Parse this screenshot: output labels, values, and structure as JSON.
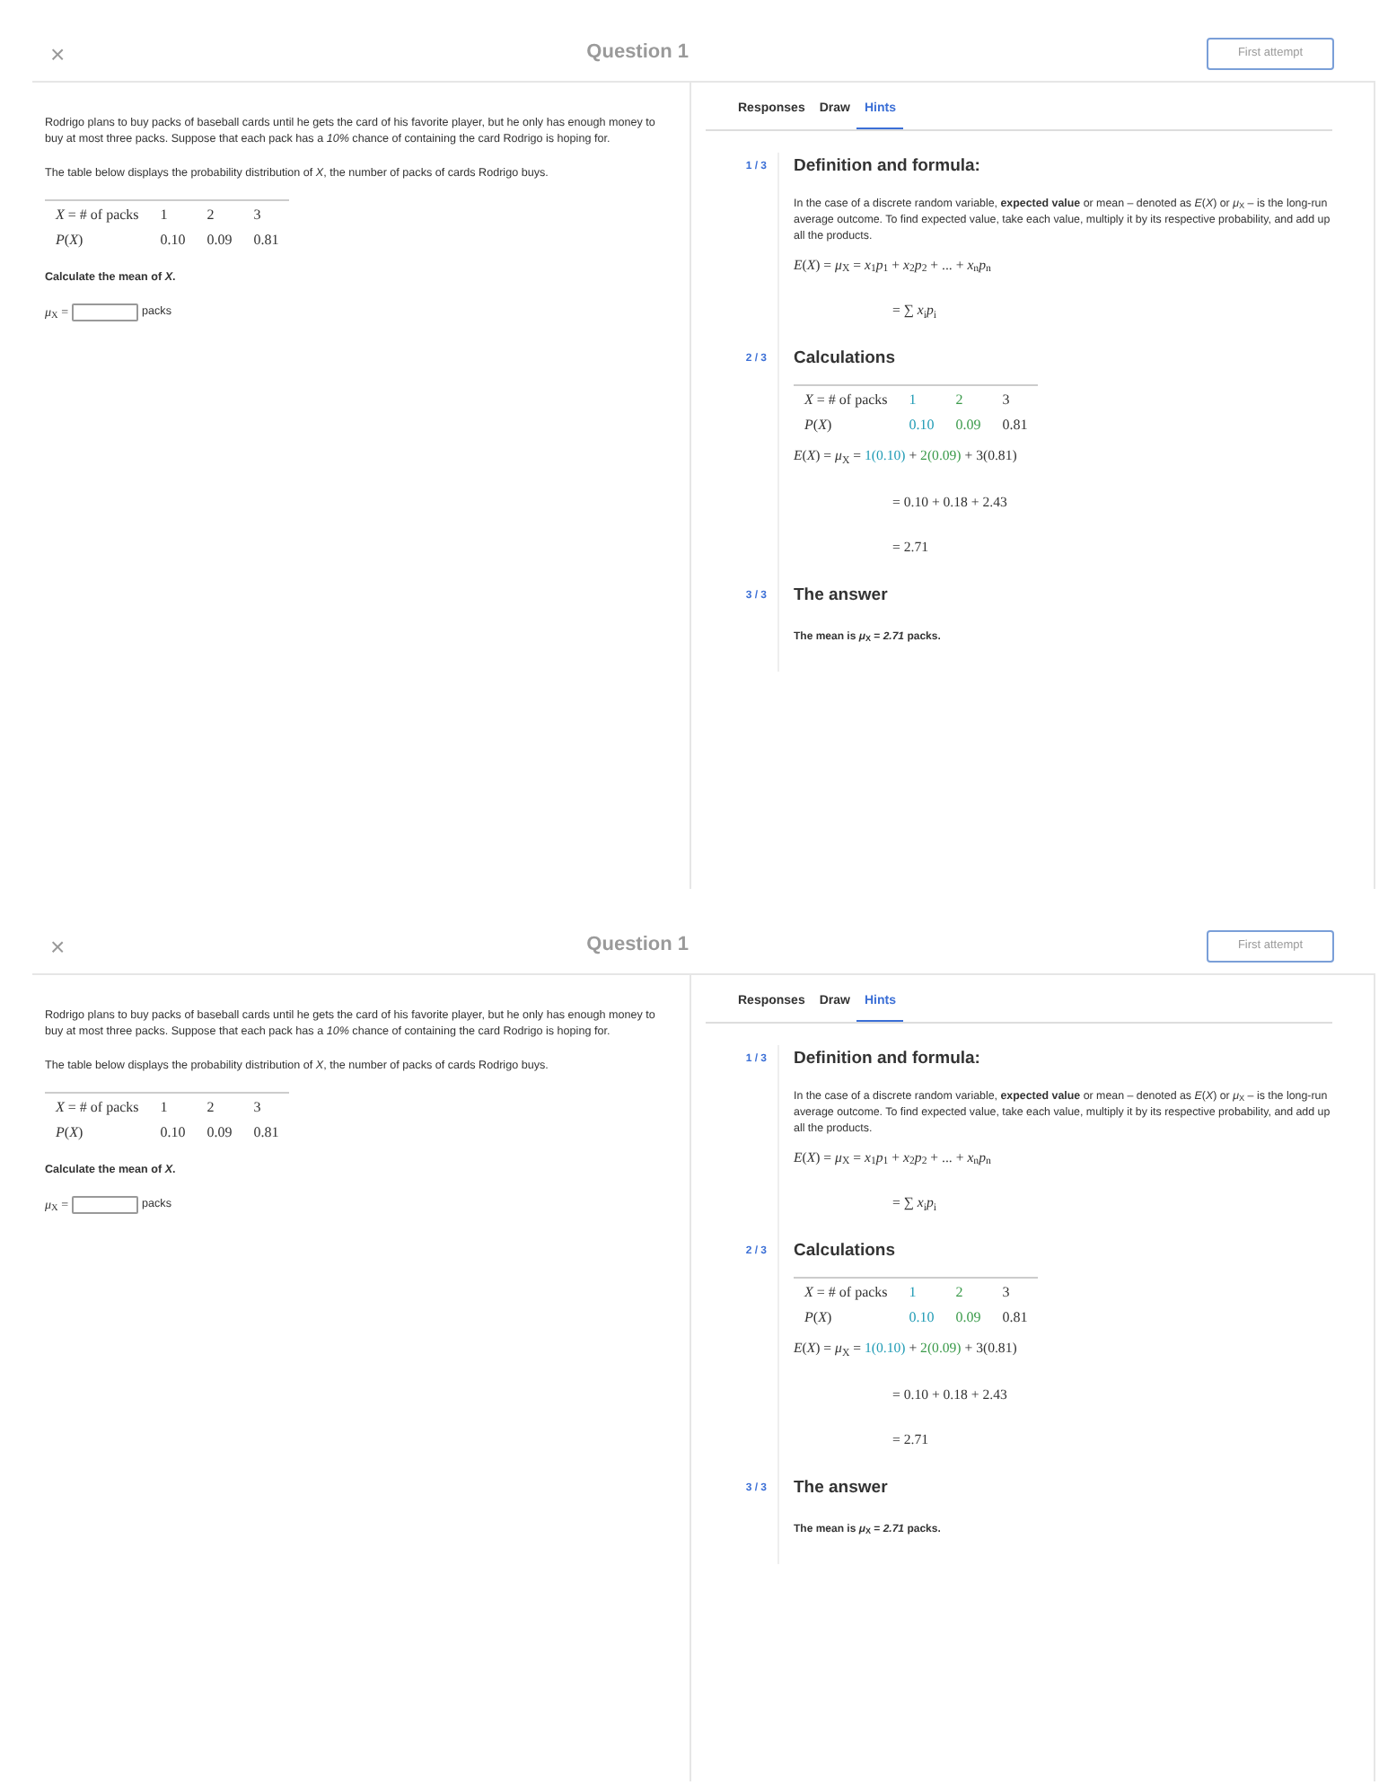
{
  "screens": [
    {
      "close": "×",
      "title": "Question 1",
      "attempt_button": "First attempt",
      "question": {
        "paragraphs": [
          "Rodrigo plans to buy packs of baseball cards until he gets the card of his favorite player, but he only has enough money to buy at most three packs. Suppose that each pack has a *10%* chance of containing the card Rodrigo is hoping for.",
          "The table below displays the probability distribution of *X*, the number of packs of cards Rodrigo buys."
        ],
        "table": [
          [
            {
              "text": "*X* = # of packs"
            },
            {
              "text": "1"
            },
            {
              "text": "2"
            },
            {
              "text": "3"
            }
          ],
          [
            {
              "text": "*P*(*X*)"
            },
            {
              "text": "0.10"
            },
            {
              "text": "0.09"
            },
            {
              "text": "0.81"
            }
          ]
        ],
        "prompt": "Calculate the mean of *X*.",
        "answer_label": "*μ*$_{X}$ =",
        "unit": "packs"
      },
      "tabs": [
        {
          "label": "Responses",
          "selected": false
        },
        {
          "label": "Draw",
          "selected": false
        },
        {
          "label": "Hints",
          "selected": true
        }
      ],
      "hints": [
        {
          "step": "1 / 3",
          "title": "Definition and formula:",
          "blocks": [
            {
              "kind": "text",
              "text": "In the case of a discrete random variable, **expected value** or mean – denoted as *E*(*X*) or *μ*$_{X}$ – is the long-run average outcome. To find expected value, take each value, multiply it by its respective probability, and add up all the products."
            },
            {
              "kind": "equation",
              "parts": [
                {
                  "text": "*E*(*X*) = *μ*$_{X}$ = *x*$_{1}$*p*$_{1}$ + *x*$_{2}$*p*$_{2}$ + ... + *x*$_{n}$*p*$_{n}$"
                }
              ]
            },
            {
              "kind": "continued",
              "parts": [
                {
                  "text": "= ∑ *x*$_{i}$*p*$_{i}$"
                }
              ]
            }
          ]
        },
        {
          "step": "2 / 3",
          "title": "Calculations",
          "blocks": [
            {
              "kind": "table",
              "rows": [
                [
                  {
                    "text": "*X* = # of packs"
                  },
                  {
                    "text": "1",
                    "color": "#1f9bb5"
                  },
                  {
                    "text": "2",
                    "color": "#3a9a4a"
                  },
                  {
                    "text": "3"
                  }
                ],
                [
                  {
                    "text": "*P*(*X*)"
                  },
                  {
                    "text": "0.10",
                    "color": "#1f9bb5"
                  },
                  {
                    "text": "0.09",
                    "color": "#3a9a4a"
                  },
                  {
                    "text": "0.81"
                  }
                ]
              ]
            },
            {
              "kind": "equation",
              "parts": [
                {
                  "text": "*E*(*X*) = *μ*$_{X}$ = "
                },
                {
                  "text": "1(0.10)",
                  "color": "#1f9bb5"
                },
                {
                  "text": " + "
                },
                {
                  "text": "2(0.09)",
                  "color": "#3a9a4a"
                },
                {
                  "text": " + 3(0.81)"
                }
              ]
            },
            {
              "kind": "continued",
              "parts": [
                {
                  "text": "= 0.10 + 0.18 + 2.43"
                }
              ]
            },
            {
              "kind": "continued",
              "parts": [
                {
                  "text": "= 2.71"
                }
              ]
            }
          ]
        },
        {
          "step": "3 / 3",
          "title": "The answer",
          "blocks": [
            {
              "kind": "answer",
              "text": "The mean is *μ*$_{X}$ = *2.71* packs."
            }
          ]
        }
      ]
    },
    {
      "close": "×",
      "title": "Question 1",
      "attempt_button": "First attempt",
      "question": {
        "paragraphs": [
          "Rodrigo plans to buy packs of baseball cards until he gets the card of his favorite player, but he only has enough money to buy at most three packs. Suppose that each pack has a *10%* chance of containing the card Rodrigo is hoping for.",
          "The table below displays the probability distribution of *X*, the number of packs of cards Rodrigo buys."
        ],
        "table": [
          [
            {
              "text": "*X* = # of packs"
            },
            {
              "text": "1"
            },
            {
              "text": "2"
            },
            {
              "text": "3"
            }
          ],
          [
            {
              "text": "*P*(*X*)"
            },
            {
              "text": "0.10"
            },
            {
              "text": "0.09"
            },
            {
              "text": "0.81"
            }
          ]
        ],
        "prompt": "Calculate the mean of *X*.",
        "answer_label": "*μ*$_{X}$ =",
        "unit": "packs"
      },
      "tabs": [
        {
          "label": "Responses",
          "selected": false
        },
        {
          "label": "Draw",
          "selected": false
        },
        {
          "label": "Hints",
          "selected": true
        }
      ],
      "hints": [
        {
          "step": "1 / 3",
          "title": "Definition and formula:",
          "blocks": [
            {
              "kind": "text",
              "text": "In the case of a discrete random variable, **expected value** or mean – denoted as *E*(*X*) or *μ*$_{X}$ – is the long-run average outcome. To find expected value, take each value, multiply it by its respective probability, and add up all the products."
            },
            {
              "kind": "equation",
              "parts": [
                {
                  "text": "*E*(*X*) = *μ*$_{X}$ = *x*$_{1}$*p*$_{1}$ + *x*$_{2}$*p*$_{2}$ + ... + *x*$_{n}$*p*$_{n}$"
                }
              ]
            },
            {
              "kind": "continued",
              "parts": [
                {
                  "text": "= ∑ *x*$_{i}$*p*$_{i}$"
                }
              ]
            }
          ]
        },
        {
          "step": "2 / 3",
          "title": "Calculations",
          "blocks": [
            {
              "kind": "table",
              "rows": [
                [
                  {
                    "text": "*X* = # of packs"
                  },
                  {
                    "text": "1",
                    "color": "#1f9bb5"
                  },
                  {
                    "text": "2",
                    "color": "#3a9a4a"
                  },
                  {
                    "text": "3"
                  }
                ],
                [
                  {
                    "text": "*P*(*X*)"
                  },
                  {
                    "text": "0.10",
                    "color": "#1f9bb5"
                  },
                  {
                    "text": "0.09",
                    "color": "#3a9a4a"
                  },
                  {
                    "text": "0.81"
                  }
                ]
              ]
            },
            {
              "kind": "equation",
              "parts": [
                {
                  "text": "*E*(*X*) = *μ*$_{X}$ = "
                },
                {
                  "text": "1(0.10)",
                  "color": "#1f9bb5"
                },
                {
                  "text": " + "
                },
                {
                  "text": "2(0.09)",
                  "color": "#3a9a4a"
                },
                {
                  "text": " + 3(0.81)"
                }
              ]
            },
            {
              "kind": "continued",
              "parts": [
                {
                  "text": "= 0.10 + 0.18 + 2.43"
                }
              ]
            },
            {
              "kind": "continued",
              "parts": [
                {
                  "text": "= 2.71"
                }
              ]
            }
          ]
        },
        {
          "step": "3 / 3",
          "title": "The answer",
          "blocks": [
            {
              "kind": "answer",
              "text": "The mean is *μ*$_{X}$ = *2.71* packs."
            }
          ]
        }
      ]
    }
  ]
}
